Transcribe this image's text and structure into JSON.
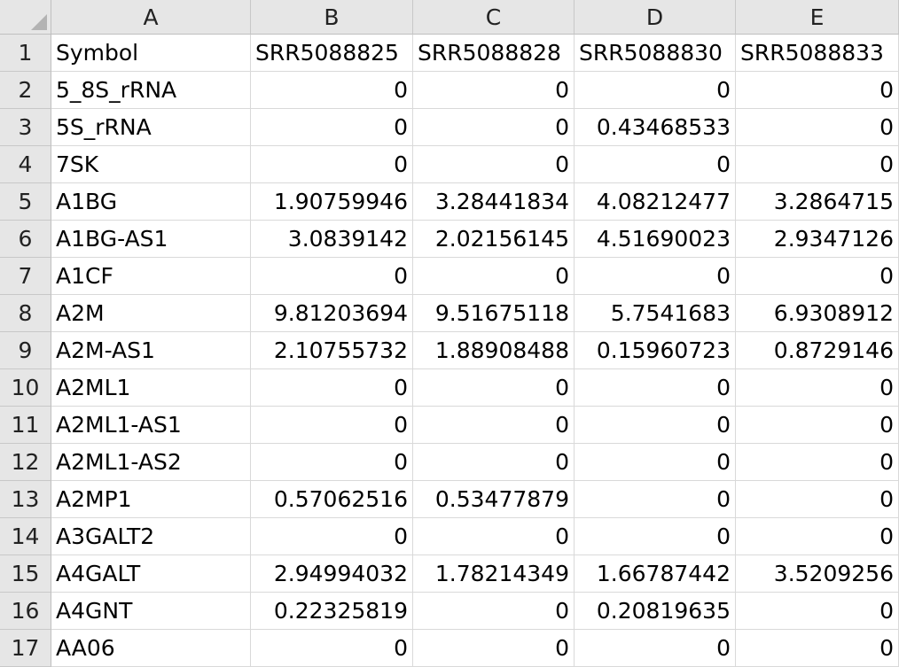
{
  "columns": [
    "A",
    "B",
    "C",
    "D",
    "E"
  ],
  "rows": [
    {
      "num": "1",
      "cells": [
        "Symbol",
        "SRR5088825",
        "SRR5088828",
        "SRR5088830",
        "SRR5088833"
      ]
    },
    {
      "num": "2",
      "cells": [
        "5_8S_rRNA",
        "0",
        "0",
        "0",
        "0"
      ]
    },
    {
      "num": "3",
      "cells": [
        "5S_rRNA",
        "0",
        "0",
        "0.43468533",
        "0"
      ]
    },
    {
      "num": "4",
      "cells": [
        "7SK",
        "0",
        "0",
        "0",
        "0"
      ]
    },
    {
      "num": "5",
      "cells": [
        "A1BG",
        "1.90759946",
        "3.28441834",
        "4.08212477",
        "3.2864715"
      ]
    },
    {
      "num": "6",
      "cells": [
        "A1BG-AS1",
        "3.0839142",
        "2.02156145",
        "4.51690023",
        "2.9347126"
      ]
    },
    {
      "num": "7",
      "cells": [
        "A1CF",
        "0",
        "0",
        "0",
        "0"
      ]
    },
    {
      "num": "8",
      "cells": [
        "A2M",
        "9.81203694",
        "9.51675118",
        "5.7541683",
        "6.9308912"
      ]
    },
    {
      "num": "9",
      "cells": [
        "A2M-AS1",
        "2.10755732",
        "1.88908488",
        "0.15960723",
        "0.8729146"
      ]
    },
    {
      "num": "10",
      "cells": [
        "A2ML1",
        "0",
        "0",
        "0",
        "0"
      ]
    },
    {
      "num": "11",
      "cells": [
        "A2ML1-AS1",
        "0",
        "0",
        "0",
        "0"
      ]
    },
    {
      "num": "12",
      "cells": [
        "A2ML1-AS2",
        "0",
        "0",
        "0",
        "0"
      ]
    },
    {
      "num": "13",
      "cells": [
        "A2MP1",
        "0.57062516",
        "0.53477879",
        "0",
        "0"
      ]
    },
    {
      "num": "14",
      "cells": [
        "A3GALT2",
        "0",
        "0",
        "0",
        "0"
      ]
    },
    {
      "num": "15",
      "cells": [
        "A4GALT",
        "2.94994032",
        "1.78214349",
        "1.66787442",
        "3.5209256"
      ]
    },
    {
      "num": "16",
      "cells": [
        "A4GNT",
        "0.22325819",
        "0",
        "0.20819635",
        "0"
      ]
    },
    {
      "num": "17",
      "cells": [
        "AA06",
        "0",
        "0",
        "0",
        "0"
      ]
    }
  ]
}
